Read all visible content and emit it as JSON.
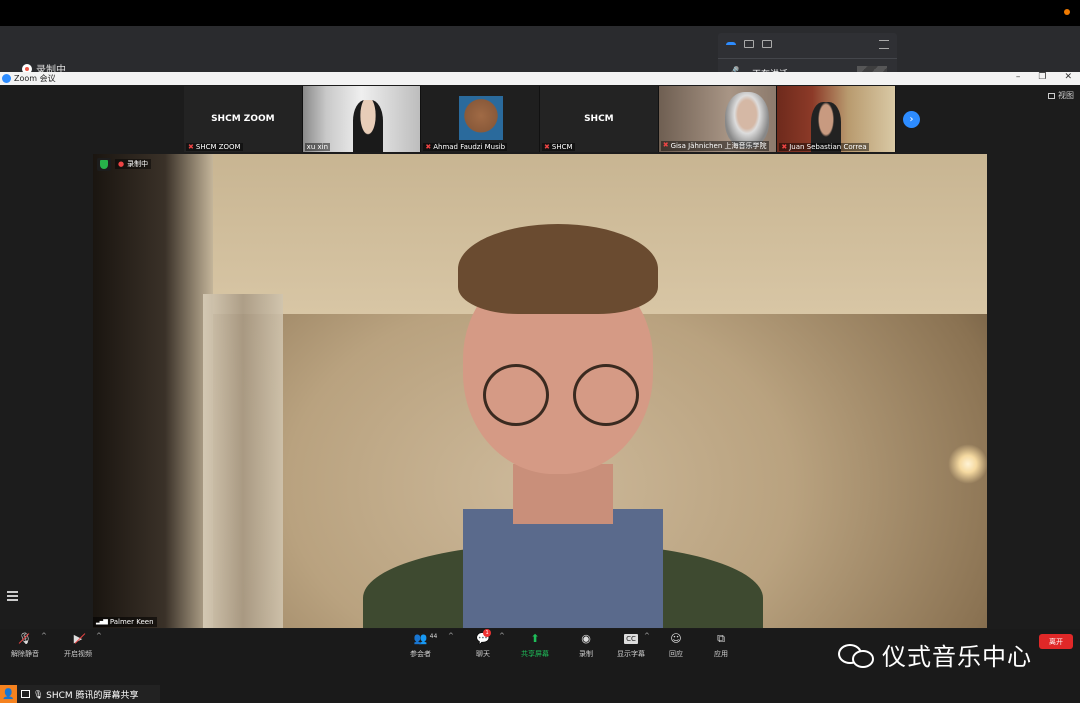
{
  "recording": {
    "label": "录制中"
  },
  "window": {
    "title": "Zoom 会议",
    "minimize": "–",
    "maximize": "❐",
    "close": "✕"
  },
  "speaking_panel": {
    "label": "正在讲话:"
  },
  "view_button": {
    "label": "视图"
  },
  "thumbnails": [
    {
      "title": "SHCM ZOOM",
      "name": "SHCM ZOOM",
      "has_video": false
    },
    {
      "title": "",
      "name": "xu xin",
      "has_video": true
    },
    {
      "title": "",
      "name": "Ahmad Faudzi Musib",
      "has_video": true
    },
    {
      "title": "SHCM",
      "name": "SHCM",
      "has_video": false
    },
    {
      "title": "",
      "name": "Gisa Jähnichen 上海音乐学院",
      "has_video": true
    },
    {
      "title": "",
      "name": "Juan Sebastian Correa",
      "has_video": true
    }
  ],
  "main_video": {
    "recording_badge": "录制中",
    "speaker_name": "Palmer Keen"
  },
  "toolbar": {
    "unmute": "解除静音",
    "start_video": "开启视频",
    "participants": "参会者",
    "participants_count": "44",
    "chat": "聊天",
    "chat_badge": "1",
    "share": "共享屏幕",
    "record": "录制",
    "captions": "显示字幕",
    "captions_icon": "CC",
    "reactions": "回应",
    "apps": "应用",
    "leave": "离开"
  },
  "watermark": {
    "text": "仪式音乐中心"
  },
  "sharebar": {
    "text": "SHCM 腾讯的屏幕共享"
  },
  "colors": {
    "accent": "#2d8cff",
    "leave": "#e02828",
    "share_green": "#1fbe59",
    "user_orange": "#f5821f"
  }
}
